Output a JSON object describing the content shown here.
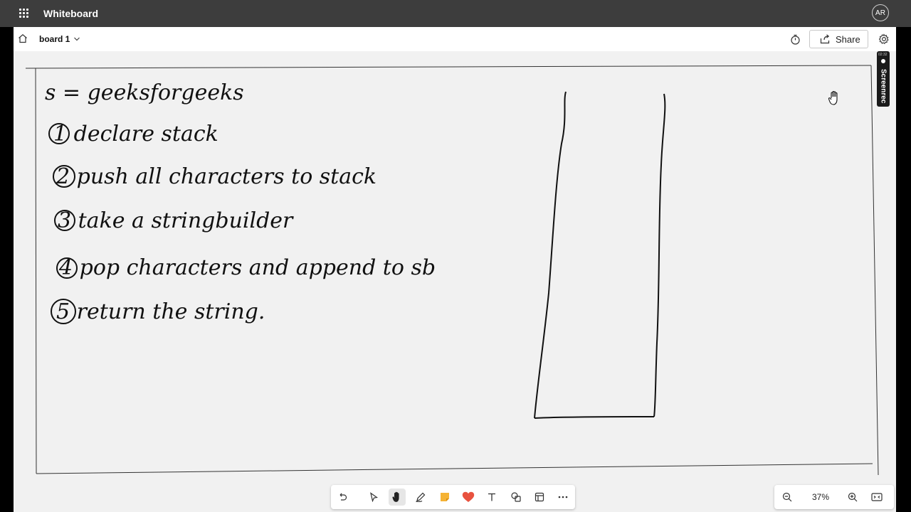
{
  "app": {
    "title": "Whiteboard",
    "avatar_initials": "AR"
  },
  "toolbar": {
    "board_name": "board 1",
    "share_label": "Share"
  },
  "recorder": {
    "time": "02:32",
    "label": "Screenrec"
  },
  "canvas": {
    "notes": [
      "s = geeksforgeeks",
      "1 declare stack",
      "2 push all characters to stack",
      "3 take a stringbuilder",
      "4 pop characters and append to sb",
      "5 return the string."
    ]
  },
  "bottom_tools": [
    "undo-icon",
    "select-icon",
    "hand-icon",
    "pen-icon",
    "sticky-note-icon",
    "reaction-icon",
    "text-icon",
    "shapes-icon",
    "template-icon",
    "more-icon"
  ],
  "zoom": {
    "level": "37%"
  },
  "colors": {
    "titlebar": "#3d3d3d",
    "canvas": "#f1f1f1",
    "reaction": "#e8523f",
    "sticky": "#f5b335"
  }
}
